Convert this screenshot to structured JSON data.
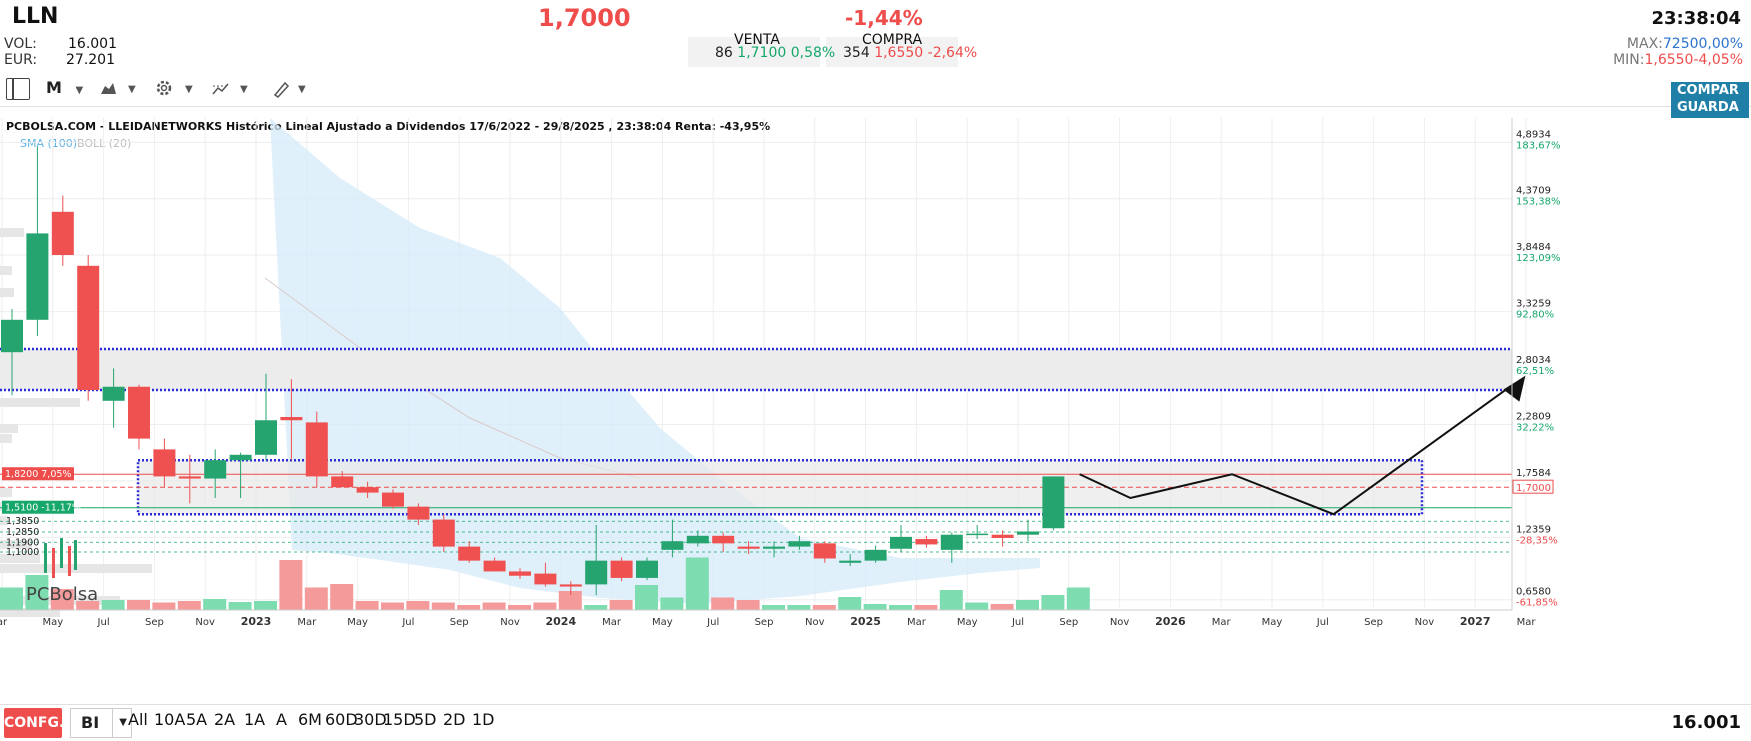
{
  "header": {
    "ticker": "LLN",
    "price": "1,7000",
    "change": "-1,44%",
    "time": "23:38:04",
    "vol_label": "VOL:",
    "vol_value": "16.001",
    "eur_label": "EUR:",
    "eur_value": "27.201",
    "venta_label": "VENTA",
    "venta_qty": "86",
    "venta_price": "1,7100",
    "venta_pct": "0,58%",
    "compra_label": "COMPRA",
    "compra_qty": "354",
    "compra_price": "1,6550",
    "compra_pct": "-2,64%",
    "max_label": "MAX:",
    "max_value": "72500,00%",
    "min_label": "MIN:",
    "min_value": "1,6550",
    "min_pct": "-4,05%"
  },
  "toolbar": {
    "period": "M",
    "compare_line1": "COMPAR",
    "compare_line2": "GUARDA"
  },
  "chart_title": "PCBOLSA.COM - LLEIDANETWORKS Histórico Lineal Ajustado a Dividendos 17/6/2022 - 29/8/2025 , 23:38:04 Renta: -43,95%",
  "legend": {
    "sma": "SMA (100)",
    "boll": "BOLL (20)"
  },
  "watermark": "PCBolsa",
  "chart_data": {
    "type": "candlestick",
    "title": "PCBOLSA.COM - LLEIDANETWORKS Histórico Lineal Ajustado a Dividendos 17/6/2022 - 29/8/2025 , 23:38:04 Renta: -43,95%",
    "x_ticks": [
      "ar",
      "May",
      "Jul",
      "Sep",
      "Nov",
      "2023",
      "Mar",
      "May",
      "Jul",
      "Sep",
      "Nov",
      "2024",
      "Mar",
      "May",
      "Jul",
      "Sep",
      "Nov",
      "2025",
      "Mar",
      "May",
      "Jul",
      "Sep",
      "Nov",
      "2026",
      "Mar",
      "May",
      "Jul",
      "Sep",
      "Nov",
      "2027",
      "Mar"
    ],
    "y_ticks": [
      {
        "price": "4,8934",
        "pct": "183,67%"
      },
      {
        "price": "4,3709",
        "pct": "153,38%"
      },
      {
        "price": "3,8484",
        "pct": "123,09%"
      },
      {
        "price": "3,3259",
        "pct": "92,80%"
      },
      {
        "price": "2,8034",
        "pct": "62,51%"
      },
      {
        "price": "2,2809",
        "pct": "32,22%"
      },
      {
        "price": "1,7584",
        "pct": ""
      },
      {
        "price": "1,2359",
        "pct": "-28,35%"
      },
      {
        "price": "0,6580",
        "pct": "-61,85%"
      }
    ],
    "ylim": [
      0.6,
      5.1
    ],
    "last_price_label": "1,7000",
    "level_labels": [
      {
        "text": "1,8200  7,05%",
        "value": 1.82,
        "color": "#ef4c4c"
      },
      {
        "text": "1,5100  -11,17%",
        "value": 1.51,
        "color": "#16a76a"
      }
    ],
    "dashed_levels": [
      {
        "text": "1,3850",
        "value": 1.385
      },
      {
        "text": "1,2850",
        "value": 1.285
      },
      {
        "text": "1,1900",
        "value": 1.19
      },
      {
        "text": "1,1000",
        "value": 1.1
      }
    ],
    "candles": [
      {
        "m": 0,
        "o": 2.95,
        "h": 3.35,
        "l": 2.55,
        "c": 3.25
      },
      {
        "m": 1,
        "o": 3.25,
        "h": 4.85,
        "l": 3.1,
        "c": 4.05
      },
      {
        "m": 2,
        "o": 4.25,
        "h": 4.4,
        "l": 3.75,
        "c": 3.85
      },
      {
        "m": 3,
        "o": 3.75,
        "h": 3.85,
        "l": 2.5,
        "c": 2.6
      },
      {
        "m": 4,
        "o": 2.5,
        "h": 2.8,
        "l": 2.25,
        "c": 2.63
      },
      {
        "m": 5,
        "o": 2.63,
        "h": 2.65,
        "l": 2.05,
        "c": 2.15
      },
      {
        "m": 6,
        "o": 2.05,
        "h": 2.15,
        "l": 1.7,
        "c": 1.8
      },
      {
        "m": 7,
        "o": 1.8,
        "h": 2.0,
        "l": 1.55,
        "c": 1.78
      },
      {
        "m": 8,
        "o": 1.78,
        "h": 2.05,
        "l": 1.6,
        "c": 1.95
      },
      {
        "m": 9,
        "o": 1.95,
        "h": 2.02,
        "l": 1.6,
        "c": 2.0
      },
      {
        "m": 10,
        "o": 2.0,
        "h": 2.75,
        "l": 1.95,
        "c": 2.32
      },
      {
        "m": 11,
        "o": 2.35,
        "h": 2.7,
        "l": 1.95,
        "c": 2.32
      },
      {
        "m": 12,
        "o": 2.3,
        "h": 2.4,
        "l": 1.7,
        "c": 1.8
      },
      {
        "m": 13,
        "o": 1.8,
        "h": 1.85,
        "l": 1.7,
        "c": 1.7
      },
      {
        "m": 14,
        "o": 1.7,
        "h": 1.75,
        "l": 1.6,
        "c": 1.65
      },
      {
        "m": 15,
        "o": 1.65,
        "h": 1.68,
        "l": 1.5,
        "c": 1.52
      },
      {
        "m": 16,
        "o": 1.52,
        "h": 1.55,
        "l": 1.35,
        "c": 1.4
      },
      {
        "m": 17,
        "o": 1.4,
        "h": 1.45,
        "l": 1.1,
        "c": 1.15
      },
      {
        "m": 18,
        "o": 1.15,
        "h": 1.2,
        "l": 1.0,
        "c": 1.02
      },
      {
        "m": 19,
        "o": 1.02,
        "h": 1.05,
        "l": 0.92,
        "c": 0.92
      },
      {
        "m": 20,
        "o": 0.92,
        "h": 0.95,
        "l": 0.85,
        "c": 0.88
      },
      {
        "m": 21,
        "o": 0.9,
        "h": 1.0,
        "l": 0.78,
        "c": 0.8
      },
      {
        "m": 22,
        "o": 0.8,
        "h": 0.83,
        "l": 0.7,
        "c": 0.78
      },
      {
        "m": 23,
        "o": 0.8,
        "h": 1.35,
        "l": 0.7,
        "c": 1.02
      },
      {
        "m": 24,
        "o": 1.02,
        "h": 1.05,
        "l": 0.83,
        "c": 0.86
      },
      {
        "m": 25,
        "o": 0.86,
        "h": 1.05,
        "l": 0.84,
        "c": 1.02
      },
      {
        "m": 26,
        "o": 1.12,
        "h": 1.4,
        "l": 1.05,
        "c": 1.2
      },
      {
        "m": 27,
        "o": 1.18,
        "h": 1.3,
        "l": 1.15,
        "c": 1.25
      },
      {
        "m": 28,
        "o": 1.25,
        "h": 1.28,
        "l": 1.1,
        "c": 1.18
      },
      {
        "m": 29,
        "o": 1.15,
        "h": 1.2,
        "l": 1.08,
        "c": 1.13
      },
      {
        "m": 30,
        "o": 1.13,
        "h": 1.2,
        "l": 1.05,
        "c": 1.15
      },
      {
        "m": 31,
        "o": 1.15,
        "h": 1.25,
        "l": 1.12,
        "c": 1.2
      },
      {
        "m": 32,
        "o": 1.18,
        "h": 1.2,
        "l": 1.0,
        "c": 1.04
      },
      {
        "m": 33,
        "o": 1.0,
        "h": 1.08,
        "l": 0.97,
        "c": 1.02
      },
      {
        "m": 34,
        "o": 1.02,
        "h": 1.16,
        "l": 1.0,
        "c": 1.12
      },
      {
        "m": 35,
        "o": 1.13,
        "h": 1.35,
        "l": 1.1,
        "c": 1.24
      },
      {
        "m": 36,
        "o": 1.22,
        "h": 1.25,
        "l": 1.14,
        "c": 1.17
      },
      {
        "m": 37,
        "o": 1.12,
        "h": 1.28,
        "l": 1.0,
        "c": 1.26
      },
      {
        "m": 38,
        "o": 1.26,
        "h": 1.35,
        "l": 1.22,
        "c": 1.27
      },
      {
        "m": 39,
        "o": 1.26,
        "h": 1.3,
        "l": 1.15,
        "c": 1.23
      },
      {
        "m": 40,
        "o": 1.26,
        "h": 1.4,
        "l": 1.2,
        "c": 1.29
      },
      {
        "m": 41,
        "o": 1.32,
        "h": 1.8,
        "l": 1.3,
        "c": 1.8
      }
    ],
    "volume_rel": [
      0.45,
      0.7,
      0.42,
      0.18,
      0.2,
      0.2,
      0.15,
      0.18,
      0.22,
      0.16,
      0.18,
      1.0,
      0.45,
      0.52,
      0.18,
      0.15,
      0.18,
      0.15,
      0.1,
      0.15,
      0.1,
      0.15,
      0.38,
      0.1,
      0.2,
      0.5,
      0.25,
      1.05,
      0.25,
      0.2,
      0.1,
      0.1,
      0.1,
      0.26,
      0.12,
      0.1,
      0.1,
      0.4,
      0.15,
      0.12,
      0.2,
      0.3,
      0.45
    ],
    "projection_path": [
      {
        "m": 44,
        "v": 1.82
      },
      {
        "m": 46,
        "v": 1.6
      },
      {
        "m": 50,
        "v": 1.82
      },
      {
        "m": 54,
        "v": 1.45
      },
      {
        "m": 61,
        "v": 2.64
      }
    ],
    "zones": [
      {
        "name": "resistance-zone",
        "from": 2.6,
        "to": 2.98
      },
      {
        "name": "consolidation-zone",
        "from": 1.45,
        "to": 1.95
      }
    ]
  },
  "bottom": {
    "config": "CONFG.",
    "bl": "BI",
    "ranges": [
      "All",
      "10A",
      "5A",
      "2A",
      "1A",
      "A",
      "6M",
      "60D",
      "30D",
      "15D",
      "5D",
      "2D",
      "1D"
    ],
    "volume": "16.001"
  }
}
